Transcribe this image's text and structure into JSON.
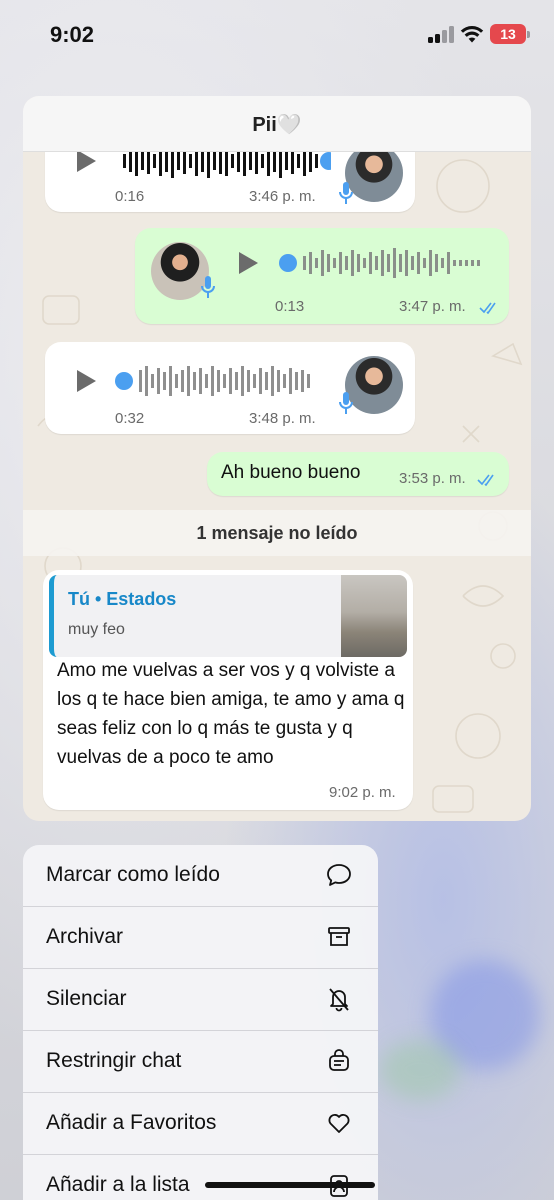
{
  "status_bar": {
    "time": "9:02",
    "battery_level": "13",
    "battery_color": "#e5484d",
    "signal_bars_active": 2,
    "signal_bars_total": 4,
    "icons": [
      "signal-icon",
      "wifi-icon",
      "battery-icon"
    ]
  },
  "chat": {
    "title": "Pii🤍",
    "messages": [
      {
        "type": "voice",
        "direction": "incoming",
        "duration": "0:16",
        "time": "3:46 p. m."
      },
      {
        "type": "voice",
        "direction": "outgoing",
        "duration": "0:13",
        "time": "3:47 p. m.",
        "status": "read"
      },
      {
        "type": "voice",
        "direction": "incoming",
        "duration": "0:32",
        "time": "3:48 p. m."
      },
      {
        "type": "text",
        "direction": "outgoing",
        "text": "Ah bueno bueno",
        "time": "3:53 p. m.",
        "status": "read"
      }
    ],
    "unread_divider": "1 mensaje no leído",
    "last_message": {
      "quote_title": "Tú • Estados",
      "quote_subtitle": "muy feo",
      "text": "Amo me vuelvas a ser vos y q volviste a los q te hace bien amiga, te amo y ama q seas feliz con lo q más te gusta y q vuelvas de a poco te amo",
      "time": "9:02 p. m."
    },
    "colors": {
      "outgoing_bubble": "#d9fdd3",
      "incoming_bubble": "#ffffff",
      "accent_blue": "#4b9ff0",
      "quote_accent": "#1d9bd1"
    }
  },
  "menu": {
    "items": [
      {
        "label": "Marcar como leído",
        "icon": "chat-bubble-icon"
      },
      {
        "label": "Archivar",
        "icon": "archive-box-icon"
      },
      {
        "label": "Silenciar",
        "icon": "bell-slash-icon"
      },
      {
        "label": "Restringir chat",
        "icon": "locked-chat-icon"
      },
      {
        "label": "Añadir a Favoritos",
        "icon": "heart-icon"
      },
      {
        "label": "Añadir a la lista",
        "icon": "list-person-icon"
      }
    ]
  }
}
